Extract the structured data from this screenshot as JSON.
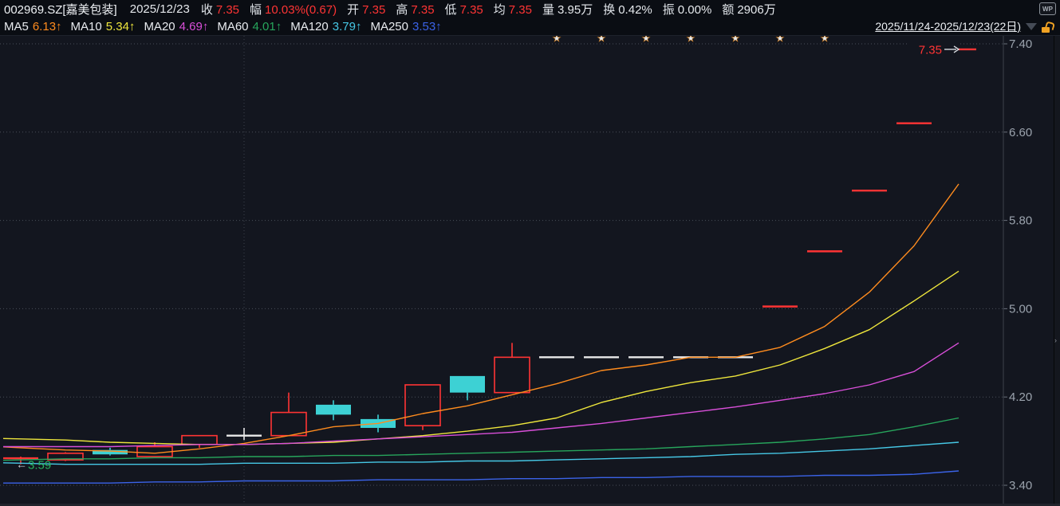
{
  "header": {
    "symbol": "002969.SZ[嘉美包装]",
    "date": "2025/12/23",
    "fields": [
      {
        "label": "收",
        "value": "7.35",
        "tone": "price"
      },
      {
        "label": "幅",
        "value": "10.03%(0.67)",
        "tone": "price"
      },
      {
        "label": "开",
        "value": "7.35",
        "tone": "price"
      },
      {
        "label": "高",
        "value": "7.35",
        "tone": "price"
      },
      {
        "label": "低",
        "value": "7.35",
        "tone": "price"
      },
      {
        "label": "均",
        "value": "7.35",
        "tone": "price"
      },
      {
        "label": "量",
        "value": "3.95万",
        "tone": "plain"
      },
      {
        "label": "换",
        "value": "0.42%",
        "tone": "plain"
      },
      {
        "label": "振",
        "value": "0.00%",
        "tone": "plain"
      },
      {
        "label": "额",
        "value": "2906万",
        "tone": "plain"
      }
    ],
    "wp_badge": "WP"
  },
  "ma_bar": {
    "items": [
      {
        "label": "MA5",
        "value": "6.13",
        "arrow": "↑",
        "color": "#ff8c1e"
      },
      {
        "label": "MA10",
        "value": "5.34",
        "arrow": "↑",
        "color": "#eee63c"
      },
      {
        "label": "MA20",
        "value": "4.69",
        "arrow": "↑",
        "color": "#d94fd9"
      },
      {
        "label": "MA60",
        "value": "4.01",
        "arrow": "↑",
        "color": "#27a55c"
      },
      {
        "label": "MA120",
        "value": "3.79",
        "arrow": "↑",
        "color": "#46c8e6"
      },
      {
        "label": "MA250",
        "value": "3.53",
        "arrow": "↑",
        "color": "#3b63e8"
      }
    ],
    "range_label": "2025/11/24-2025/12/23(22日)"
  },
  "chart_data": {
    "type": "candlestick",
    "title": "002969.SZ 嘉美包装 日K线",
    "date_range": "2025/11/24-2025/12/23",
    "num_days": 22,
    "y_ticks": [
      7.4,
      6.6,
      5.8,
      5.0,
      4.2,
      3.4
    ],
    "colors": {
      "up": "#ff3434",
      "down": "#3dd1d4",
      "flat": "#e9e9e9",
      "low_label": "#28b45f"
    },
    "candles": [
      {
        "o": 3.645,
        "h": 3.66,
        "l": 3.59,
        "c": 3.645,
        "t": "up"
      },
      {
        "o": 3.63,
        "h": 3.7,
        "l": 3.62,
        "c": 3.69,
        "t": "up"
      },
      {
        "o": 3.72,
        "h": 3.74,
        "l": 3.67,
        "c": 3.68,
        "t": "down"
      },
      {
        "o": 3.66,
        "h": 3.79,
        "l": 3.66,
        "c": 3.75,
        "t": "up"
      },
      {
        "o": 3.77,
        "h": 3.85,
        "l": 3.74,
        "c": 3.85,
        "t": "up"
      },
      {
        "o": 3.85,
        "h": 3.92,
        "l": 3.81,
        "c": 3.85,
        "t": "flat"
      },
      {
        "o": 3.85,
        "h": 4.24,
        "l": 3.85,
        "c": 4.06,
        "t": "up"
      },
      {
        "o": 4.13,
        "h": 4.17,
        "l": 3.99,
        "c": 4.04,
        "t": "down"
      },
      {
        "o": 4.0,
        "h": 4.04,
        "l": 3.88,
        "c": 3.92,
        "t": "down"
      },
      {
        "o": 3.94,
        "h": 4.31,
        "l": 3.9,
        "c": 4.31,
        "t": "up"
      },
      {
        "o": 4.39,
        "h": 4.39,
        "l": 4.17,
        "c": 4.24,
        "t": "down"
      },
      {
        "o": 4.24,
        "h": 4.69,
        "l": 4.24,
        "c": 4.56,
        "t": "up"
      },
      {
        "o": 4.56,
        "h": 4.56,
        "l": 4.56,
        "c": 4.56,
        "t": "flat"
      },
      {
        "o": 4.56,
        "h": 4.56,
        "l": 4.56,
        "c": 4.56,
        "t": "flat"
      },
      {
        "o": 4.56,
        "h": 4.56,
        "l": 4.56,
        "c": 4.56,
        "t": "flat"
      },
      {
        "o": 4.56,
        "h": 4.56,
        "l": 4.56,
        "c": 4.56,
        "t": "flat"
      },
      {
        "o": 4.56,
        "h": 4.56,
        "l": 4.56,
        "c": 4.56,
        "t": "flat"
      },
      {
        "o": 5.02,
        "h": 5.02,
        "l": 5.02,
        "c": 5.02,
        "t": "up"
      },
      {
        "o": 5.52,
        "h": 5.52,
        "l": 5.52,
        "c": 5.52,
        "t": "up"
      },
      {
        "o": 6.07,
        "h": 6.07,
        "l": 6.07,
        "c": 6.07,
        "t": "up"
      },
      {
        "o": 6.68,
        "h": 6.68,
        "l": 6.68,
        "c": 6.68,
        "t": "up"
      },
      {
        "o": 7.35,
        "h": 7.35,
        "l": 7.35,
        "c": 7.35,
        "t": "up"
      }
    ],
    "ma_series": [
      {
        "name": "MA5",
        "color": "#ff8c1e",
        "values": [
          3.74,
          3.72,
          3.71,
          3.69,
          3.73,
          3.78,
          3.85,
          3.93,
          3.96,
          4.05,
          4.12,
          4.22,
          4.32,
          4.44,
          4.49,
          4.56,
          4.56,
          4.65,
          4.84,
          5.15,
          5.57,
          6.13
        ]
      },
      {
        "name": "MA10",
        "color": "#eee63c",
        "values": [
          3.82,
          3.81,
          3.79,
          3.78,
          3.77,
          3.77,
          3.78,
          3.79,
          3.82,
          3.85,
          3.89,
          3.94,
          4.01,
          4.15,
          4.25,
          4.33,
          4.39,
          4.49,
          4.64,
          4.81,
          5.07,
          5.34
        ]
      },
      {
        "name": "MA20",
        "color": "#d94fd9",
        "values": [
          3.75,
          3.75,
          3.75,
          3.76,
          3.77,
          3.77,
          3.78,
          3.8,
          3.82,
          3.84,
          3.86,
          3.88,
          3.92,
          3.96,
          4.01,
          4.06,
          4.11,
          4.17,
          4.23,
          4.31,
          4.43,
          4.69
        ]
      },
      {
        "name": "MA60",
        "color": "#27a55c",
        "values": [
          3.63,
          3.64,
          3.64,
          3.65,
          3.65,
          3.66,
          3.66,
          3.67,
          3.67,
          3.68,
          3.69,
          3.7,
          3.71,
          3.72,
          3.73,
          3.75,
          3.77,
          3.79,
          3.82,
          3.86,
          3.93,
          4.01
        ]
      },
      {
        "name": "MA120",
        "color": "#46c8e6",
        "values": [
          3.6,
          3.59,
          3.59,
          3.59,
          3.59,
          3.6,
          3.6,
          3.6,
          3.61,
          3.61,
          3.62,
          3.62,
          3.63,
          3.64,
          3.65,
          3.66,
          3.68,
          3.69,
          3.71,
          3.73,
          3.76,
          3.79
        ]
      },
      {
        "name": "MA250",
        "color": "#3b63e8",
        "values": [
          3.42,
          3.42,
          3.42,
          3.43,
          3.43,
          3.44,
          3.44,
          3.44,
          3.45,
          3.45,
          3.45,
          3.46,
          3.46,
          3.47,
          3.47,
          3.48,
          3.48,
          3.48,
          3.49,
          3.49,
          3.5,
          3.53
        ]
      }
    ],
    "star_marker_candles": [
      13,
      14,
      15,
      16,
      17,
      18,
      19
    ],
    "month_separator_candle": 6,
    "low_marker": {
      "price": 3.59,
      "label": "3.59"
    },
    "last_price_marker": {
      "price": 7.35,
      "label": "7.35"
    }
  }
}
